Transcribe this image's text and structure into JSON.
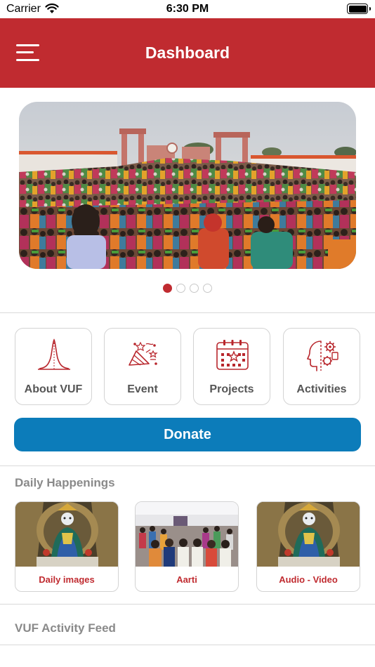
{
  "status_bar": {
    "carrier": "Carrier",
    "time": "6:30 PM"
  },
  "nav": {
    "title": "Dashboard",
    "menu_icon": "hamburger-menu-icon",
    "color": "#c02b30"
  },
  "carousel": {
    "total_pages": 4,
    "current_page": 1
  },
  "quick_menu": [
    {
      "label": "About VUF",
      "icon": "bell-curve-icon"
    },
    {
      "label": "Event",
      "icon": "party-popper-icon"
    },
    {
      "label": "Projects",
      "icon": "calendar-icon"
    },
    {
      "label": "Activities",
      "icon": "gear-head-icon"
    }
  ],
  "donate": {
    "label": "Donate",
    "color": "#0c7cba"
  },
  "daily_happenings": {
    "title": "Daily Happenings",
    "cards": [
      {
        "label": "Daily images"
      },
      {
        "label": "Aarti"
      },
      {
        "label": "Audio - Video"
      }
    ]
  },
  "activity_feed": {
    "title": "VUF Activity Feed"
  }
}
